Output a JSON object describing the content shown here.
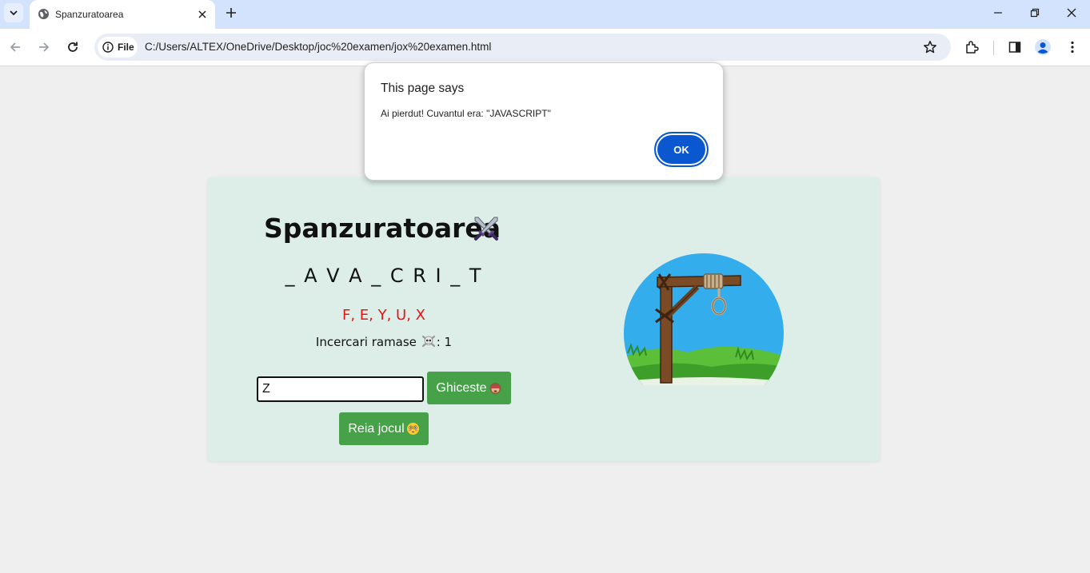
{
  "browser": {
    "tab_title": "Spanzuratoarea",
    "chip_label": "File",
    "url": "C:/Users/ALTEX/OneDrive/Desktop/joc%20examen/jox%20examen.html"
  },
  "game": {
    "title": "Spanzuratoarea",
    "word_display": "_ A V A _ C R I _ T",
    "wrong_letters": "F, E, Y, U, X",
    "attempts_label": "Incercari ramase",
    "attempts_sep": ": ",
    "attempts_value": "1",
    "guess_value": "Z",
    "guess_button": "Ghiceste",
    "reset_button": "Reia jocul"
  },
  "dialog": {
    "title": "This page says",
    "message": "Ai pierdut! Cuvantul era: \"JAVASCRIPT\"",
    "ok_label": "OK"
  },
  "colors": {
    "accent_blue": "#0b57d0",
    "button_green": "#46a149",
    "wrong_red": "#e31515",
    "card_bg": "#ddeee8"
  },
  "icons": [
    "tab-search-icon",
    "globe-icon",
    "close-icon",
    "plus-icon",
    "minimize-icon",
    "restore-icon",
    "back-icon",
    "forward-icon",
    "reload-icon",
    "info-icon",
    "star-icon",
    "extensions-icon",
    "side-panel-icon",
    "profile-icon",
    "menu-icon",
    "crossed-swords-icon",
    "skull-icon",
    "monkey-emoji-icon",
    "flushed-face-icon",
    "gallows-image"
  ]
}
